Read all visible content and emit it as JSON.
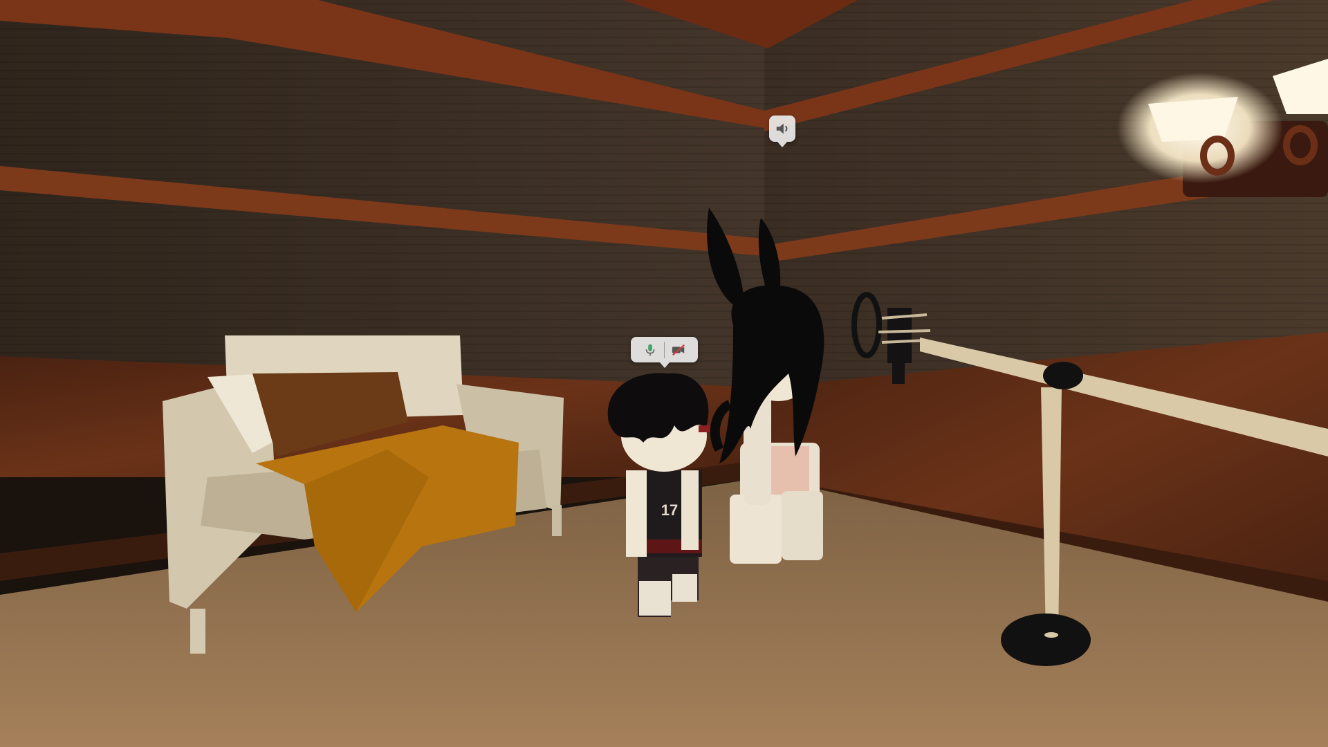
{
  "hud": {
    "speaker_indicator": {
      "icon": "speaker-volume-icon",
      "state": "audio-on"
    },
    "voice_chat_indicator": {
      "mic_icon": "microphone-icon",
      "mic_color": "#3fa46a",
      "camera_icon": "camera-off-icon",
      "camera_color": "#d43d3d"
    }
  },
  "scene": {
    "colors": {
      "wall_dark": "#3b2e22",
      "wall_stripe": "#8a3f1c",
      "wood_panel": "#5a2a14",
      "carpet": "#9a7652",
      "sofa": "#d8ccb4",
      "blanket": "#b7740f",
      "pillow_brown": "#6b3b17",
      "stanchion_pole": "#d9c9a6",
      "lamp_light": "#fff6de"
    },
    "jersey_text": "17"
  }
}
